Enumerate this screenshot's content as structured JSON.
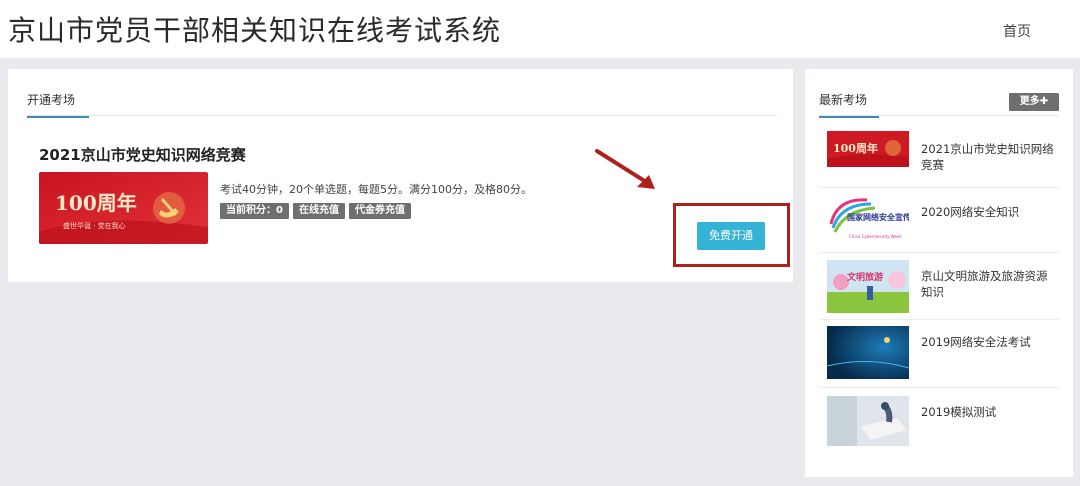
{
  "header": {
    "title": "京山市党员干部相关知识在线考试系统",
    "nav_home": "首页"
  },
  "main": {
    "tab_label": "开通考场",
    "exam": {
      "title": "2021京山市党史知识网络竞赛",
      "thumb_text": "100周年",
      "thumb_subtext": "盛世华诞 · 党在我心",
      "description": "考试40分钟，20个单选题，每题5分。满分100分，及格80分。",
      "badges": [
        "当前积分：0",
        "在线充值",
        "代金券充值"
      ],
      "action_label": "免费开通"
    }
  },
  "sidebar": {
    "tab_label": "最新考场",
    "more_label": "更多✚",
    "items": [
      {
        "label": "2021京山市党史知识网络竞赛",
        "thumb_text": "100周年"
      },
      {
        "label": "2020网络安全知识",
        "thumb_text": "国家网络安全宣传周",
        "thumb_subtext": "China Cybersecurity Week"
      },
      {
        "label": "京山文明旅游及旅游资源知识",
        "thumb_text": "文明旅游"
      },
      {
        "label": "2019网络安全法考试"
      },
      {
        "label": "2019模拟测试"
      }
    ]
  },
  "colors": {
    "accent_tab": "#3b8ea5",
    "button": "#35b3d6",
    "highlight": "#b0201b",
    "badge": "#6f6f6f"
  }
}
